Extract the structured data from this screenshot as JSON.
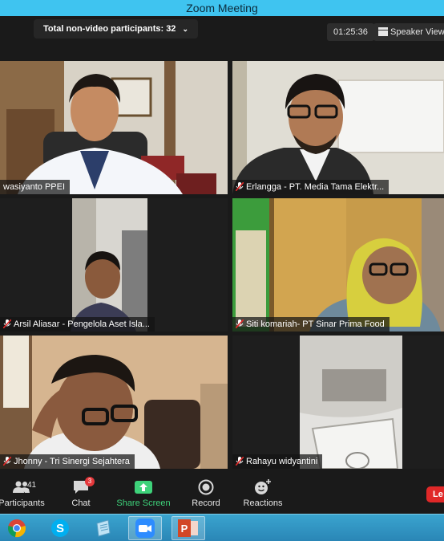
{
  "window": {
    "title": "Zoom Meeting"
  },
  "topbar": {
    "participants_pill": "Total non-video participants: 32",
    "timer": "01:25:36",
    "view_mode": "Speaker View"
  },
  "tiles": [
    {
      "name": "wasiyanto PPEI",
      "muted": false
    },
    {
      "name": "Erlangga - PT. Media Tama Elektr...",
      "muted": true
    },
    {
      "name": "Arsil Aliasar - Pengelola Aset Isla...",
      "muted": true
    },
    {
      "name": "Siti komariah- PT Sinar Prima Food",
      "muted": true
    },
    {
      "name": "Jhonny - Tri Sinergi Sejahtera",
      "muted": true
    },
    {
      "name": "Rahayu widyantini",
      "muted": true
    }
  ],
  "toolbar": {
    "participants": {
      "label": "Participants",
      "count": "41"
    },
    "chat": {
      "label": "Chat",
      "badge": "3"
    },
    "share": {
      "label": "Share Screen"
    },
    "record": {
      "label": "Record"
    },
    "reactions": {
      "label": "Reactions"
    },
    "leave": {
      "label": "Le"
    }
  },
  "taskbar": {
    "apps": [
      "chrome-icon",
      "skype-icon",
      "notepad-icon",
      "zoom-icon",
      "powerpoint-icon"
    ]
  },
  "colors": {
    "titlebar": "#3fc4f0",
    "share_green": "#3ed27a",
    "leave_red": "#e02828",
    "badge_red": "#e5383b",
    "taskbar": "#2a86b6"
  }
}
